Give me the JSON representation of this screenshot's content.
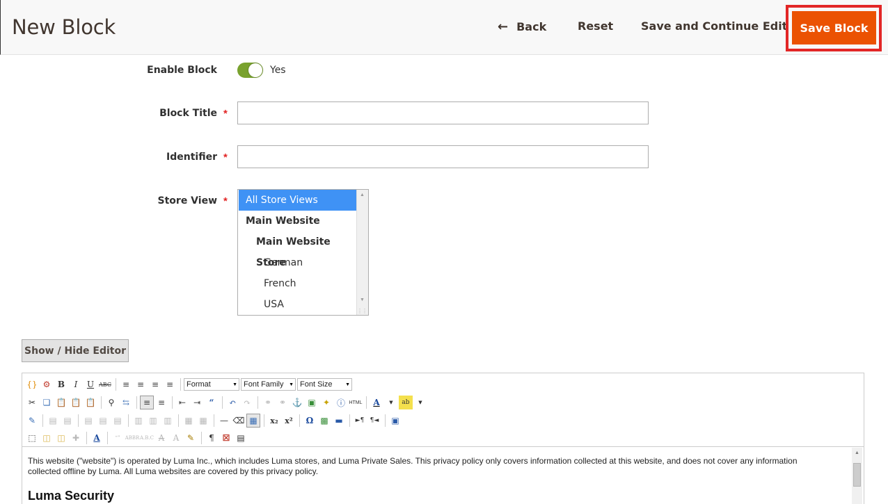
{
  "header": {
    "title": "New Block",
    "back_label": "Back",
    "reset_label": "Reset",
    "save_continue_label": "Save and Continue Edit",
    "save_label": "Save Block"
  },
  "form": {
    "enable_label": "Enable Block",
    "enable_value": "Yes",
    "title_label": "Block Title",
    "title_value": "",
    "identifier_label": "Identifier",
    "identifier_value": "",
    "store_view_label": "Store View",
    "store_options": [
      {
        "label": "All Store Views",
        "selected": true
      },
      {
        "label": "Main Website"
      },
      {
        "label": "Main Website Store"
      },
      {
        "label": "German"
      },
      {
        "label": "French"
      },
      {
        "label": "USA"
      }
    ]
  },
  "editor": {
    "toggle_label": "Show / Hide Editor",
    "format_label": "Format",
    "font_family_label": "Font Family",
    "font_size_label": "Font Size",
    "body_text": "This website (\"website\") is operated by Luma Inc., which includes Luma stores, and Luma Private Sales. This privacy policy only covers information collected at this website, and does not cover any information collected offline by Luma. All Luma websites are covered by this privacy policy.",
    "body_heading": "Luma Security"
  },
  "colors": {
    "primary_button": "#eb5202",
    "highlight": "#e22626",
    "toggle_on": "#79a22e",
    "selected_option": "#3f92f5"
  }
}
